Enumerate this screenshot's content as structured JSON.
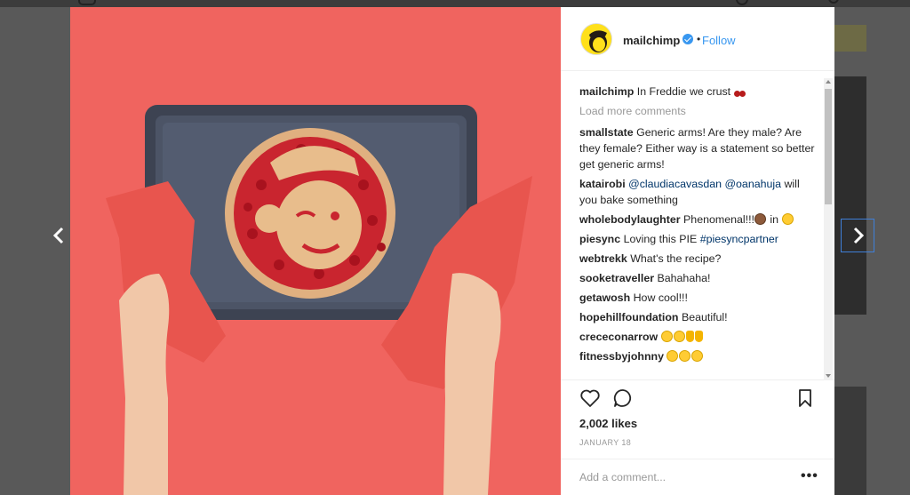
{
  "post": {
    "username": "mailchimp",
    "follow_label": "Follow",
    "separator": "•",
    "caption_user": "mailchimp",
    "caption_text": "In Freddie we crust",
    "load_more": "Load more comments",
    "likes": "2,002 likes",
    "date": "JANUARY 18",
    "add_comment_placeholder": "Add a comment...",
    "more_options": "•••"
  },
  "comments": [
    {
      "user": "smallstate",
      "text": "Generic arms! Are they male? Are they female? Either way is a statement so better get generic arms!"
    },
    {
      "user": "katairobi",
      "mention1": "@claudiacavasdan",
      "mention2": "@oanahuja",
      "text": "will you bake something"
    },
    {
      "user": "wholebodylaughter",
      "text": "Phenomenal!!!",
      "text2": "in"
    },
    {
      "user": "piesync",
      "text": "Loving this PIE",
      "mention1": "#piesyncpartner"
    },
    {
      "user": "webtrekk",
      "text": "What's the recipe?"
    },
    {
      "user": "sooketraveller",
      "text": "Bahahaha!"
    },
    {
      "user": "getawosh",
      "text": "How cool!!!"
    },
    {
      "user": "hopehillfoundation",
      "text": "Beautiful!"
    },
    {
      "user": "crececonarrow"
    },
    {
      "user": "fitnessbyjohnny"
    }
  ],
  "icons": {
    "like": "heart-icon",
    "comment": "comment-icon",
    "save": "bookmark-icon",
    "verified": "verified-badge-icon",
    "prev": "chevron-left-icon",
    "next": "chevron-right-icon"
  },
  "colors": {
    "link": "#3897f0",
    "mention": "#003569",
    "photo_bg": "#f0645f",
    "nav_focus": "#3f7fd8"
  }
}
